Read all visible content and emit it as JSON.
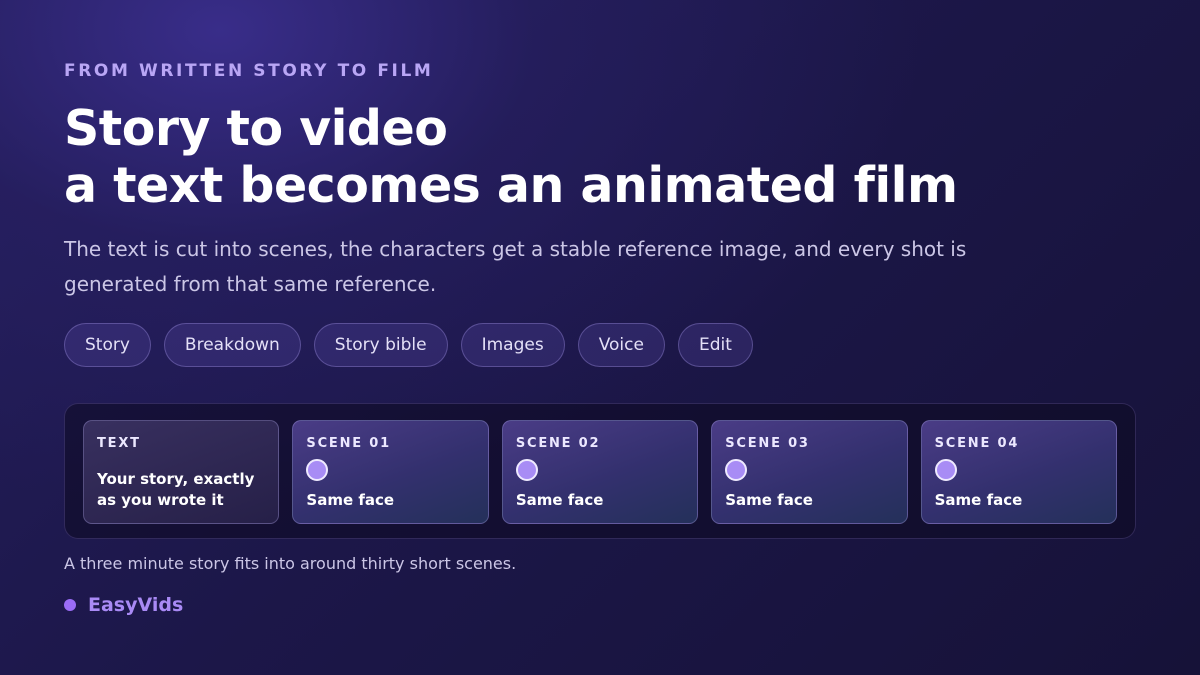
{
  "eyebrow": "FROM WRITTEN STORY TO FILM",
  "headline": {
    "line1": "Story to video",
    "line2": "a text becomes an animated film"
  },
  "lead": "The text is cut into scenes, the characters get a stable reference image, and every shot is generated from that same reference.",
  "pills": [
    {
      "label": "Story"
    },
    {
      "label": "Breakdown"
    },
    {
      "label": "Story bible"
    },
    {
      "label": "Images"
    },
    {
      "label": "Voice"
    },
    {
      "label": "Edit"
    }
  ],
  "strip": {
    "text_card": {
      "label": "TEXT",
      "body": "Your story, exactly as you wrote it"
    },
    "scenes": [
      {
        "label": "SCENE 01",
        "body": "Same face"
      },
      {
        "label": "SCENE 02",
        "body": "Same face"
      },
      {
        "label": "SCENE 03",
        "body": "Same face"
      },
      {
        "label": "SCENE 04",
        "body": "Same face"
      }
    ]
  },
  "caption": "A three minute story fits into around thirty short scenes.",
  "brand": {
    "name": "EasyVids"
  },
  "colors": {
    "accent": "#a88cf5",
    "eyebrow": "#b9a6f5",
    "brand": "#a98af5",
    "background": "#1c1749"
  }
}
